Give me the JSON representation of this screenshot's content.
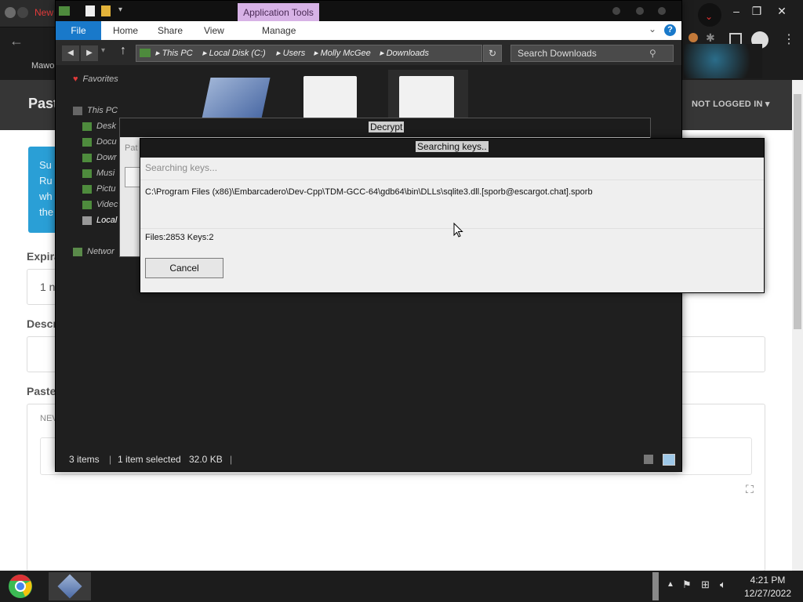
{
  "browser": {
    "tab_title": "New",
    "site_logo": "Past",
    "not_logged_in": "NOT LOGGED IN",
    "info_lines": [
      "Su",
      "Ru",
      "wh",
      "the"
    ],
    "labels": {
      "expiration": "Expira",
      "description": "Descr",
      "paste": "Paste"
    },
    "expiration_value": "1 n",
    "paste_tab": "NEV",
    "side_label": "Mawo"
  },
  "explorer": {
    "app_tools": "Application Tools",
    "ribbon": {
      "file": "File",
      "home": "Home",
      "share": "Share",
      "view": "View",
      "manage": "Manage"
    },
    "address": [
      "This PC",
      "Local Disk (C:)",
      "Users",
      "Molly McGee",
      "Downloads"
    ],
    "search_placeholder": "Search Downloads",
    "nav": {
      "favorites": "Favorites",
      "this_pc": "This PC",
      "items": [
        "Desk",
        "Docu",
        "Dowr",
        "Musi",
        "Pictu",
        "Videc",
        "Local"
      ],
      "network": "Networ"
    },
    "partial_label": "Pat",
    "status": {
      "items": "3 items",
      "selected": "1 item selected",
      "size": "32.0 KB"
    }
  },
  "decrypt_window": {
    "title": "Decrypt"
  },
  "searching_dialog": {
    "title": "Searching keys..",
    "status": "Searching keys...",
    "path": "C:\\Program Files (x86)\\Embarcadero\\Dev-Cpp\\TDM-GCC-64\\gdb64\\bin\\DLLs\\sqlite3.dll.[sporb@escargot.chat].sporb",
    "counts": "Files:2853 Keys:2",
    "cancel": "Cancel"
  },
  "taskbar": {
    "time": "4:21 PM",
    "date": "12/27/2022"
  },
  "colors": {
    "ribbon_accent": "#1979ca",
    "app_tools": "#d7b2e6",
    "info_box": "#2a9fd6"
  },
  "icons": [
    "chrome-icon",
    "folder-icon",
    "heart-icon",
    "computer-icon",
    "network-icon",
    "refresh-icon",
    "search-icon",
    "help-icon",
    "cursor-icon"
  ]
}
